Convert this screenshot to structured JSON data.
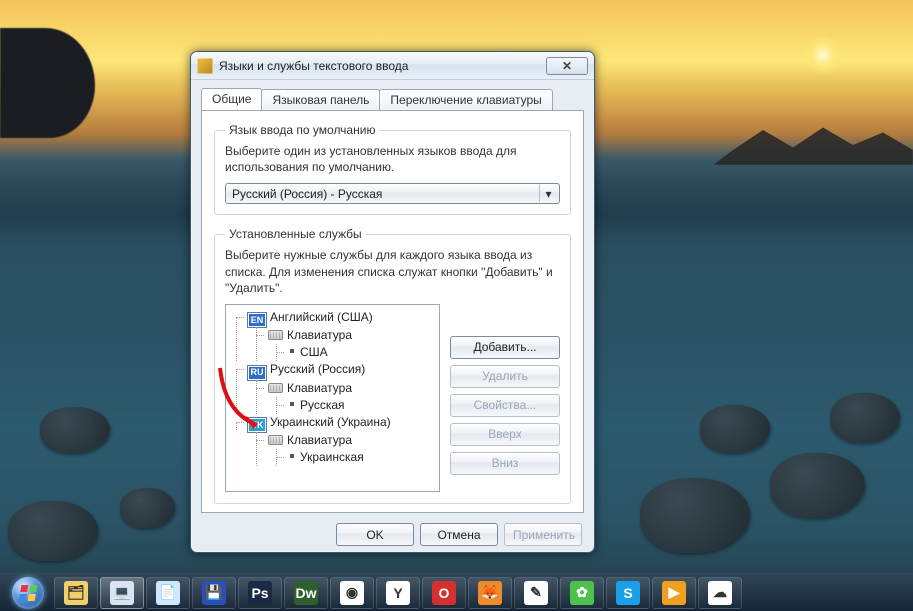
{
  "dialog": {
    "title": "Языки и службы текстового ввода",
    "tabs": [
      "Общие",
      "Языковая панель",
      "Переключение клавиатуры"
    ],
    "active_tab": 0,
    "default_group": {
      "legend": "Язык ввода по умолчанию",
      "text": "Выберите один из установленных языков ввода для использования по умолчанию.",
      "combo_value": "Русский (Россия) - Русская"
    },
    "services_group": {
      "legend": "Установленные службы",
      "text": "Выберите нужные службы для каждого языка ввода из списка. Для изменения списка служат кнопки \"Добавить\" и \"Удалить\".",
      "langs": [
        {
          "badge": "EN",
          "badge_class": "badge-en",
          "name": "Английский (США)",
          "kb_label": "Клавиатура",
          "layout": "США"
        },
        {
          "badge": "RU",
          "badge_class": "badge-ru",
          "name": "Русский (Россия)",
          "kb_label": "Клавиатура",
          "layout": "Русская"
        },
        {
          "badge": "UK",
          "badge_class": "badge-uk",
          "name": "Украинский (Украина)",
          "kb_label": "Клавиатура",
          "layout": "Украинская"
        }
      ],
      "buttons": {
        "add": "Добавить...",
        "remove": "Удалить",
        "properties": "Свойства...",
        "up": "Вверх",
        "down": "Вниз"
      }
    },
    "footer": {
      "ok": "OK",
      "cancel": "Отмена",
      "apply": "Применить"
    }
  },
  "taskbar": {
    "start": "Start",
    "items": [
      {
        "name": "file-explorer",
        "color": "#f3cf6a",
        "glyph": "🗂"
      },
      {
        "name": "regional-settings",
        "color": "#d9e4f0",
        "glyph": "💻",
        "active": true
      },
      {
        "name": "notepad",
        "color": "#cfe8ff",
        "glyph": "📄"
      },
      {
        "name": "save-diskette",
        "color": "#2a4fbb",
        "glyph": "💾"
      },
      {
        "name": "photoshop",
        "color": "#1a2a44",
        "glyph": "Ps"
      },
      {
        "name": "dreamweaver",
        "color": "#2f5e2f",
        "glyph": "Dw"
      },
      {
        "name": "chrome",
        "color": "#ffffff",
        "glyph": "◉"
      },
      {
        "name": "yandex",
        "color": "#ffffff",
        "glyph": "Y"
      },
      {
        "name": "opera",
        "color": "#d62f2f",
        "glyph": "O"
      },
      {
        "name": "firefox",
        "color": "#f08a2a",
        "glyph": "🦊"
      },
      {
        "name": "notes",
        "color": "#ffffff",
        "glyph": "✎"
      },
      {
        "name": "icq",
        "color": "#4cc24c",
        "glyph": "✿"
      },
      {
        "name": "skype",
        "color": "#1aa0e8",
        "glyph": "S"
      },
      {
        "name": "media-player",
        "color": "#f0a020",
        "glyph": "▶"
      },
      {
        "name": "mail",
        "color": "#ffffff",
        "glyph": "☁"
      }
    ]
  }
}
